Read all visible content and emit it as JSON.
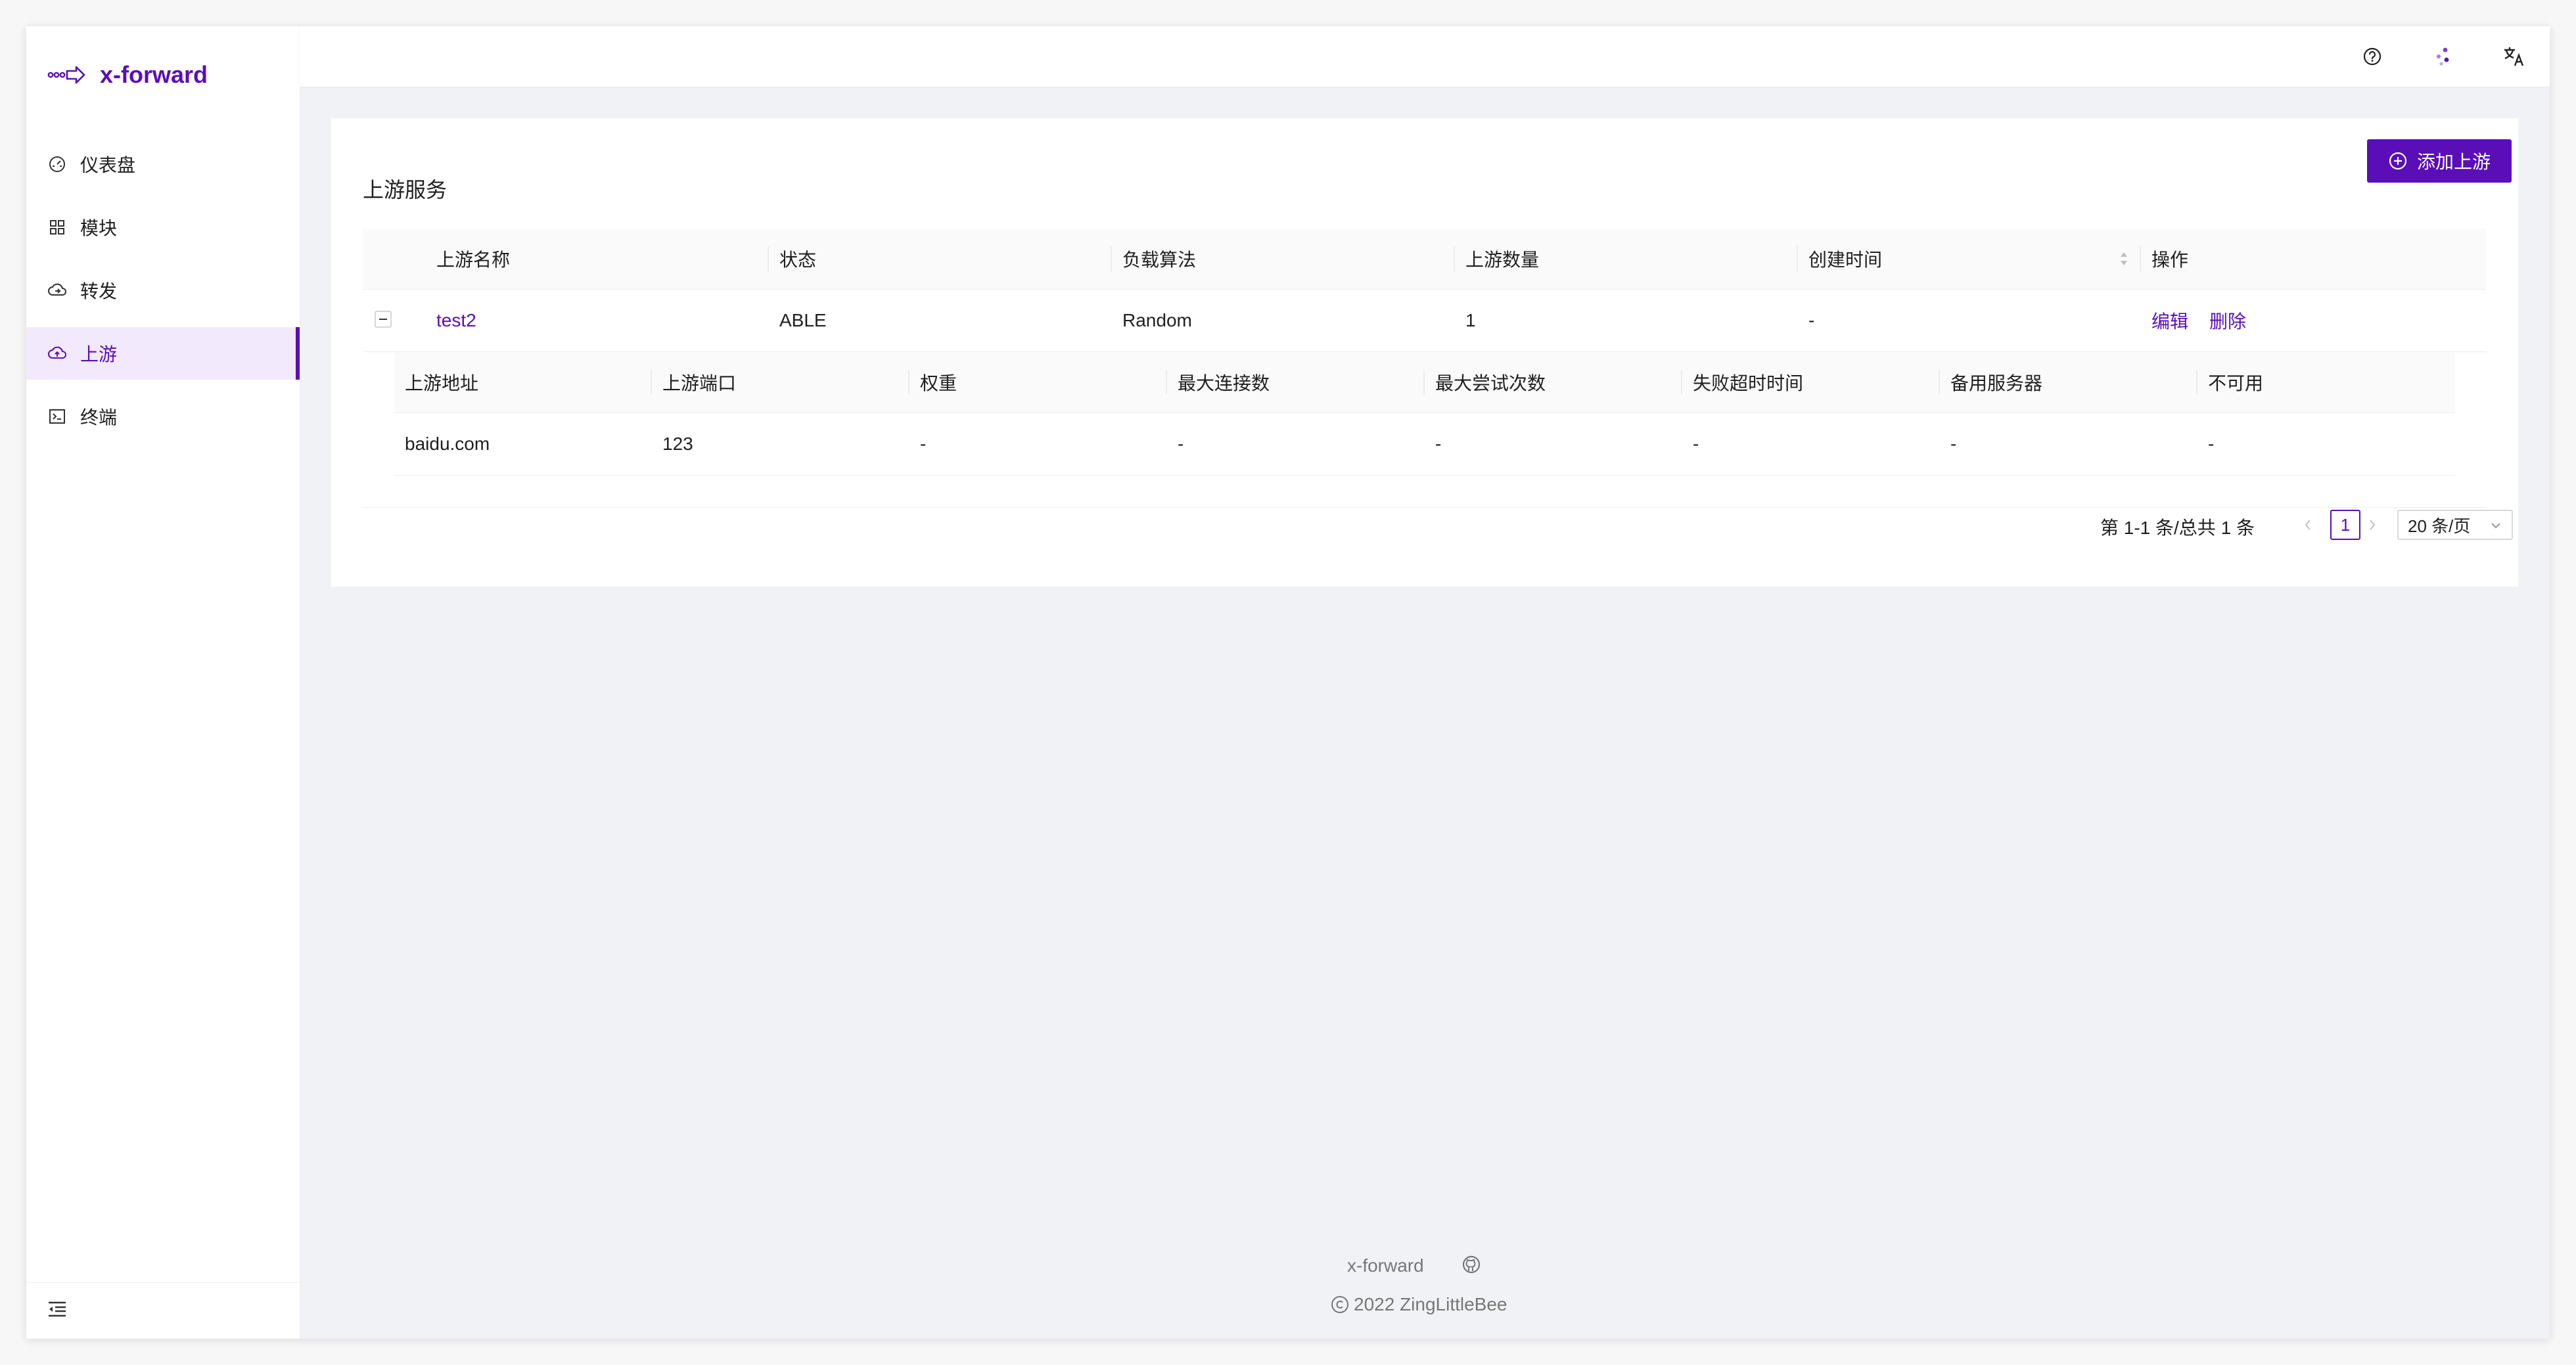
{
  "app": {
    "name": "x-forward"
  },
  "sidebar": {
    "items": [
      {
        "label": "仪表盘",
        "icon": "dashboard-icon"
      },
      {
        "label": "模块",
        "icon": "apps-icon"
      },
      {
        "label": "转发",
        "icon": "cloud-forward-icon"
      },
      {
        "label": "上游",
        "icon": "cloud-upload-icon",
        "active": true
      },
      {
        "label": "终端",
        "icon": "terminal-icon"
      }
    ],
    "collapse_icon": "menu-fold-icon"
  },
  "header": {
    "icons": [
      "help-icon",
      "theme-dots-icon",
      "translate-icon"
    ]
  },
  "card": {
    "title": "上游服务",
    "add_button": "添加上游",
    "columns": [
      "上游名称",
      "状态",
      "负载算法",
      "上游数量",
      "创建时间",
      "操作"
    ],
    "rows": [
      {
        "name": "test2",
        "status": "ABLE",
        "algorithm": "Random",
        "count": "1",
        "created": "-",
        "actions": [
          "编辑",
          "删除"
        ],
        "expanded": true,
        "nested": {
          "columns": [
            "上游地址",
            "上游端口",
            "权重",
            "最大连接数",
            "最大尝试次数",
            "失败超时时间",
            "备用服务器",
            "不可用"
          ],
          "rows": [
            [
              "baidu.com",
              "123",
              "-",
              "-",
              "-",
              "-",
              "-",
              "-"
            ]
          ]
        }
      }
    ]
  },
  "pagination": {
    "total_text": "第 1-1 条/总共 1 条",
    "current_page": "1",
    "page_size": "20 条/页"
  },
  "footer": {
    "name": "x-forward",
    "copyright": "2022 ZingLittleBee"
  },
  "colors": {
    "accent": "#5a0eb8",
    "active_bg": "#f3e9fc",
    "page_bg": "#f0f2f5"
  }
}
